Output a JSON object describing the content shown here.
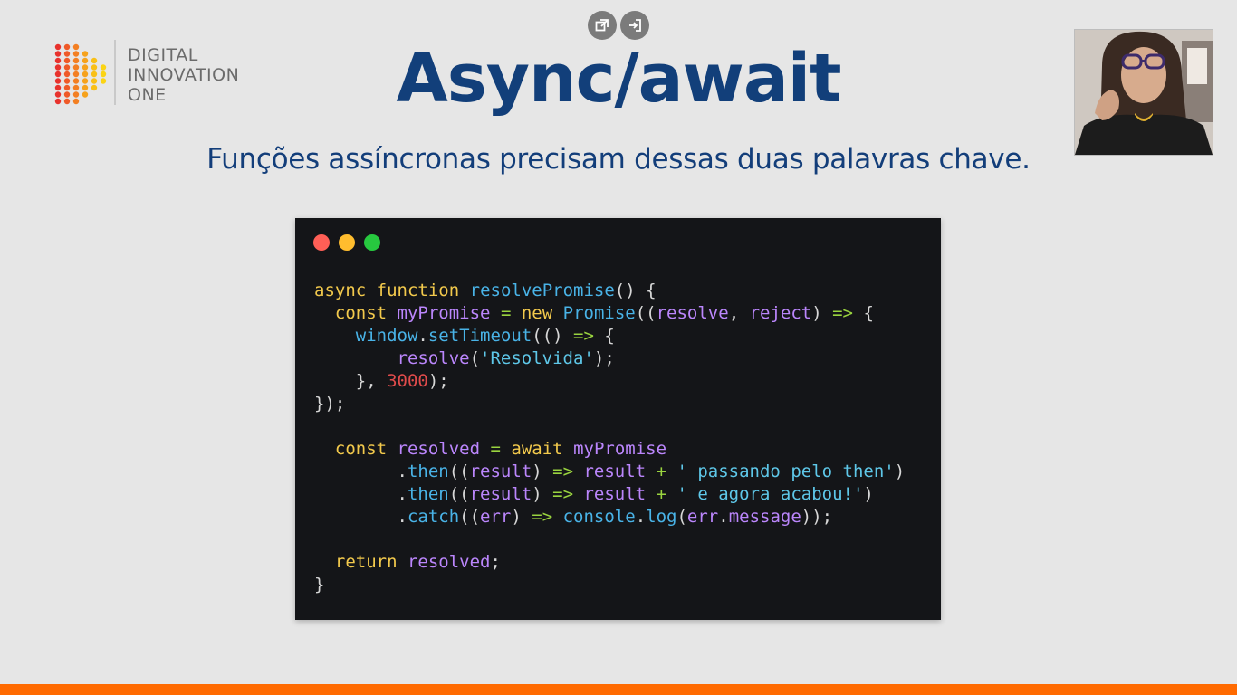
{
  "controls": {
    "popout_icon": "popout-icon",
    "exit_icon": "exit-icon"
  },
  "logo": {
    "line1": "DIGITAL",
    "line2": "INNOVATION",
    "line3": "ONE"
  },
  "slide": {
    "title": "Async/await",
    "subtitle": "Funções assíncronas precisam dessas duas palavras chave."
  },
  "code": {
    "lines": [
      "async function resolvePromise() {",
      "  const myPromise = new Promise((resolve, reject) => {",
      "    window.setTimeout(() => {",
      "        resolve('Resolvida');",
      "    }, 3000);",
      "});",
      "",
      "  const resolved = await myPromise",
      "        .then((result) => result + ' passando pelo then')",
      "        .then((result) => result + ' e agora acabou!')",
      "        .catch((err) => console.log(err.message));",
      "",
      "  return resolved;",
      "}"
    ]
  },
  "colors": {
    "title": "#123f7a",
    "accent_bar": "#ff6a00",
    "dot_red": "#ff5f56",
    "dot_yellow": "#ffbd2e",
    "dot_green": "#27c93f"
  }
}
